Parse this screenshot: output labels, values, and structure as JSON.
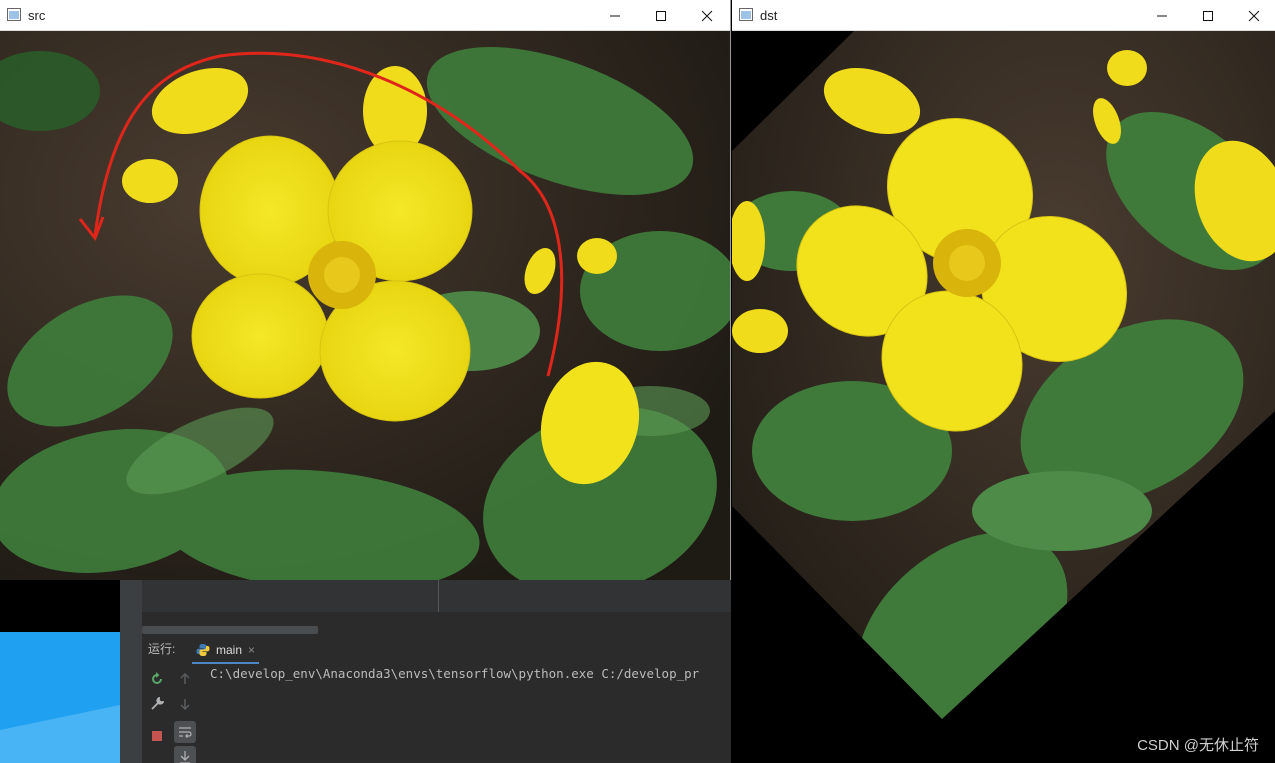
{
  "windows": {
    "src": {
      "title": "src"
    },
    "dst": {
      "title": "dst"
    }
  },
  "controls": {
    "minimize": "minimize",
    "maximize": "maximize",
    "close": "close"
  },
  "ide": {
    "run_label": "运行:",
    "tab_label": "main",
    "tab_close": "×",
    "console_line": "C:\\develop_env\\Anaconda3\\envs\\tensorflow\\python.exe C:/develop_pr"
  },
  "watermark": "CSDN @无休止符",
  "colors": {
    "flower": "#f2e21c",
    "flower_center": "#d9b40a",
    "leaf": "#3f7a3a",
    "soil": "#3a3128",
    "annotation_arrow": "#e0261b",
    "ide_bg": "#2b2b2b",
    "desktop_blue": "#1fa0f0"
  }
}
